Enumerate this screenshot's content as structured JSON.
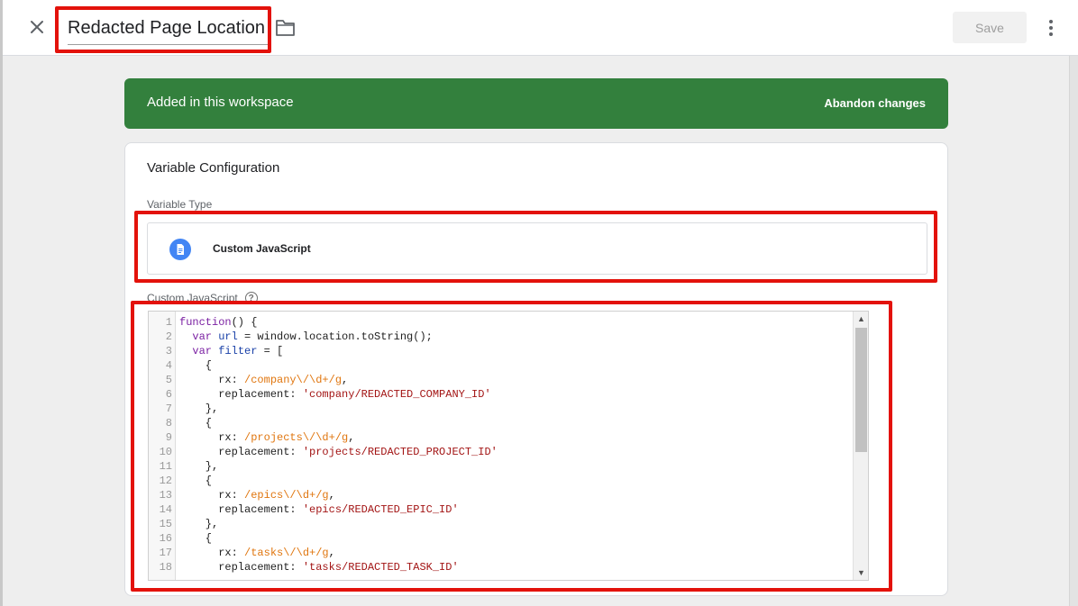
{
  "header": {
    "title": "Redacted Page Location",
    "save_label": "Save"
  },
  "banner": {
    "message": "Added in this workspace",
    "action": "Abandon changes",
    "color": "#33803d"
  },
  "card": {
    "title": "Variable Configuration",
    "variable_type_label": "Variable Type",
    "variable_type": "Custom JavaScript",
    "code_label": "Custom JavaScript"
  },
  "code": {
    "lines": [
      "function() {",
      "  var url = window.location.toString();",
      "  var filter = [",
      "    {",
      "      rx: /company\\/\\d+/g,",
      "      replacement: 'company/REDACTED_COMPANY_ID'",
      "    },",
      "    {",
      "      rx: /projects\\/\\d+/g,",
      "      replacement: 'projects/REDACTED_PROJECT_ID'",
      "    },",
      "    {",
      "      rx: /epics\\/\\d+/g,",
      "      replacement: 'epics/REDACTED_EPIC_ID'",
      "    },",
      "    {",
      "      rx: /tasks\\/\\d+/g,",
      "      replacement: 'tasks/REDACTED_TASK_ID'"
    ]
  },
  "colors": {
    "highlight": "#e3120b",
    "icon_blue": "#4285f4"
  },
  "icons": [
    "close-icon",
    "folder-icon",
    "more-vert-icon",
    "document-icon",
    "help-icon",
    "chevron-up-icon",
    "chevron-down-icon"
  ]
}
